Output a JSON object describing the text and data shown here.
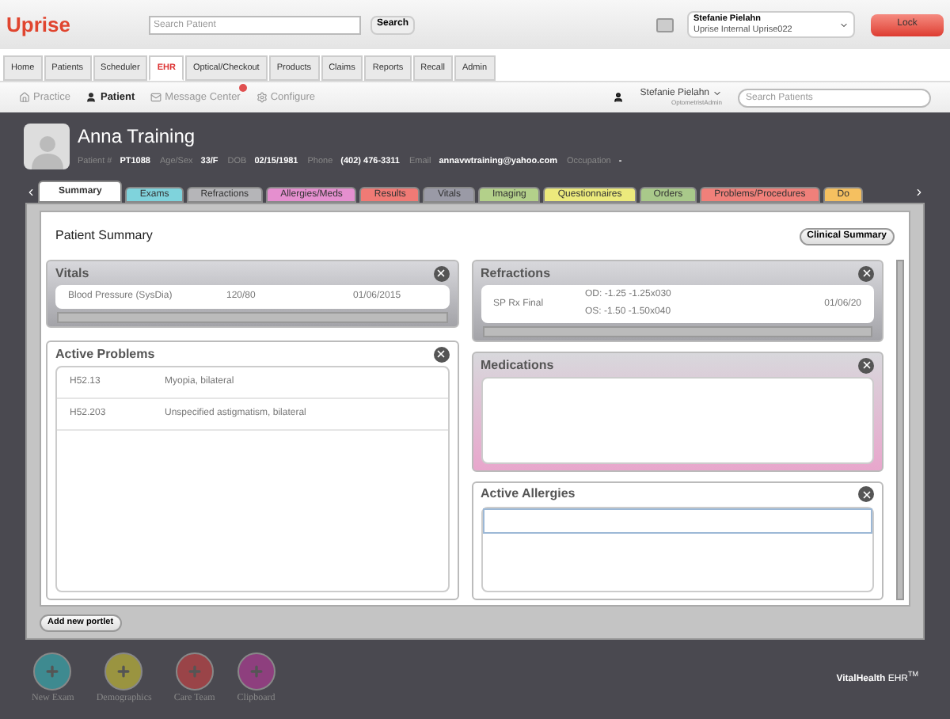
{
  "header": {
    "logo": "Uprise",
    "search": {
      "placeholder": "Search Patient"
    },
    "search_button": "Search",
    "user": {
      "name": "Stefanie Pielahn",
      "org": "Uprise Internal Uprise022"
    },
    "lock_button": "Lock"
  },
  "modules": [
    {
      "label": "Home",
      "selected": false
    },
    {
      "label": "Patients",
      "selected": false
    },
    {
      "label": "Scheduler",
      "selected": false
    },
    {
      "label": "EHR",
      "selected": true
    },
    {
      "label": "Optical/Checkout",
      "selected": false
    },
    {
      "label": "Products",
      "selected": false
    },
    {
      "label": "Claims",
      "selected": false
    },
    {
      "label": "Reports",
      "selected": false
    },
    {
      "label": "Recall",
      "selected": false
    },
    {
      "label": "Admin",
      "selected": false
    }
  ],
  "subnav": {
    "items": [
      {
        "label": "Practice",
        "kind": "practice",
        "selected": false
      },
      {
        "label": "Patient",
        "kind": "patient",
        "selected": true
      },
      {
        "label": "Message Center",
        "kind": "message",
        "selected": false
      },
      {
        "label": "Configure",
        "kind": "configure",
        "selected": false
      }
    ],
    "user": {
      "name": "Stefanie Pielahn",
      "role": "OptometristAdmin"
    },
    "search": {
      "placeholder": "Search Patients"
    }
  },
  "patient": {
    "name": "Anna Training",
    "fields": [
      {
        "label": "Patient #",
        "value": "PT1088"
      },
      {
        "label": "Age/Sex",
        "value": "33/F"
      },
      {
        "label": "DOB",
        "value": "02/15/1981"
      },
      {
        "label": "Phone",
        "value": "(402) 476-3311"
      },
      {
        "label": "Email",
        "value": "annavwtraining@yahoo.com"
      },
      {
        "label": "Occupation",
        "value": "-"
      }
    ]
  },
  "tabs": [
    {
      "label": "Summary",
      "selected": true,
      "color": "#ffffff"
    },
    {
      "label": "Exams",
      "selected": false,
      "color": "#7fd3dc"
    },
    {
      "label": "Refractions",
      "selected": false,
      "color": "#b5b5b8"
    },
    {
      "label": "Allergies/Meds",
      "selected": false,
      "color": "#e58fcf"
    },
    {
      "label": "Results",
      "selected": false,
      "color": "#f07a75"
    },
    {
      "label": "Vitals",
      "selected": false,
      "color": "#9a9aa6"
    },
    {
      "label": "Imaging",
      "selected": false,
      "color": "#b3d08a"
    },
    {
      "label": "Questionnaires",
      "selected": false,
      "color": "#ecea7c"
    },
    {
      "label": "Orders",
      "selected": false,
      "color": "#a9c98a"
    },
    {
      "label": "Problems/Procedures",
      "selected": false,
      "color": "#f0807a"
    },
    {
      "label": "Do",
      "selected": false,
      "color": "#f5c060"
    }
  ],
  "summary": {
    "title": "Patient Summary",
    "clinical_button": "Clinical Summary",
    "left": [
      {
        "title": "Vitals",
        "kind": "scroll",
        "color": "#a3a3a8",
        "rows": [
          [
            "Blood Pressure (SysDia)",
            "120/80",
            "01/06/2015"
          ]
        ]
      },
      {
        "title": "Active Problems",
        "kind": "list",
        "color": "#ffffff",
        "rows": [
          [
            "H52.13",
            "Myopia, bilateral"
          ],
          [
            "H52.203",
            "Unspecified astigmatism, bilateral"
          ]
        ]
      }
    ],
    "right": [
      {
        "title": "Refractions",
        "kind": "refraction",
        "color": "#a3a3a8",
        "rows": [
          [
            "SP Rx Final",
            "OD: -1.25 -1.25x030",
            "OS: -1.50 -1.50x040",
            "01/06/20"
          ]
        ]
      },
      {
        "title": "Medications",
        "kind": "empty",
        "color": "#e8a6cc"
      },
      {
        "title": "Active Allergies",
        "kind": "field",
        "color": "#ffffff"
      }
    ]
  },
  "add_button": "Add new portlet",
  "dock": [
    {
      "label": "New Exam",
      "color": "#3e8a90"
    },
    {
      "label": "Demographics",
      "color": "#9a9440"
    },
    {
      "label": "Care Team",
      "color": "#9a4448"
    },
    {
      "label": "Clipboard",
      "color": "#8e3f7e"
    }
  ],
  "brand": {
    "name": "VitalHealth",
    "product": "EHR",
    "mark": "TM"
  }
}
